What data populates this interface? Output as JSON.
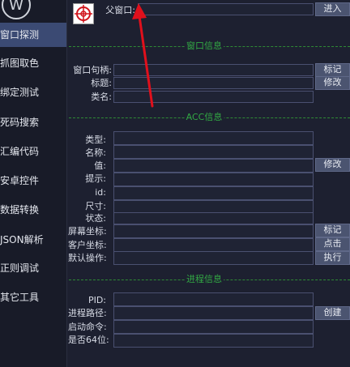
{
  "sidebar": {
    "logo": "W",
    "items": [
      {
        "label": "窗口探测",
        "active": true
      },
      {
        "label": "抓图取色"
      },
      {
        "label": "绑定测试"
      },
      {
        "label": "死码搜索"
      },
      {
        "label": "汇编代码"
      },
      {
        "label": "安卓控件"
      },
      {
        "label": "数据转换"
      },
      {
        "label": "JSON解析"
      },
      {
        "label": "正则调试"
      },
      {
        "label": "其它工具"
      }
    ]
  },
  "top": {
    "parent_label": "父窗口:",
    "enter_button": "进入"
  },
  "window_info": {
    "section_title": "窗口信息",
    "handle_label": "窗口句柄:",
    "title_label": "标题:",
    "class_label": "类名:",
    "mark_button": "标记",
    "modify_button": "修改"
  },
  "acc_info": {
    "section_title": "ACC信息",
    "type_label": "类型:",
    "name_label": "名称:",
    "value_label": "值:",
    "hint_label": "提示:",
    "id_label": "id:",
    "size_label": "尺寸:",
    "state_label": "状态:",
    "screen_coord_label": "屏幕坐标:",
    "client_coord_label": "客户坐标:",
    "default_action_label": "默认操作:",
    "modify_button": "修改",
    "mark_button": "标记",
    "click_button": "点击",
    "execute_button": "执行"
  },
  "process_info": {
    "section_title": "进程信息",
    "pid_label": "PID:",
    "path_label": "进程路径:",
    "cmd_label": "启动命令:",
    "is64_label": "是否64位:",
    "create_button": "创建"
  },
  "colors": {
    "accent": "#3b4a73",
    "separator": "#2f8a35",
    "arrow": "#e0101c"
  }
}
